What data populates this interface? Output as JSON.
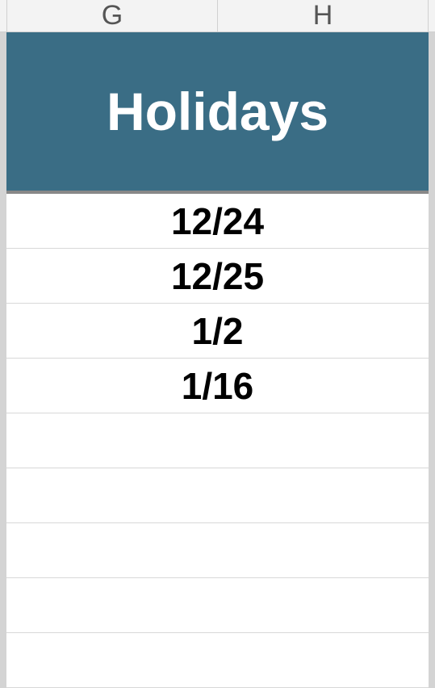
{
  "columns": {
    "col_g": "G",
    "col_h": "H"
  },
  "title": "Holidays",
  "colors": {
    "title_bg": "#3a6d85",
    "title_fg": "#ffffff"
  },
  "holidays": [
    "12/24",
    "12/25",
    "1/2",
    "1/16"
  ]
}
